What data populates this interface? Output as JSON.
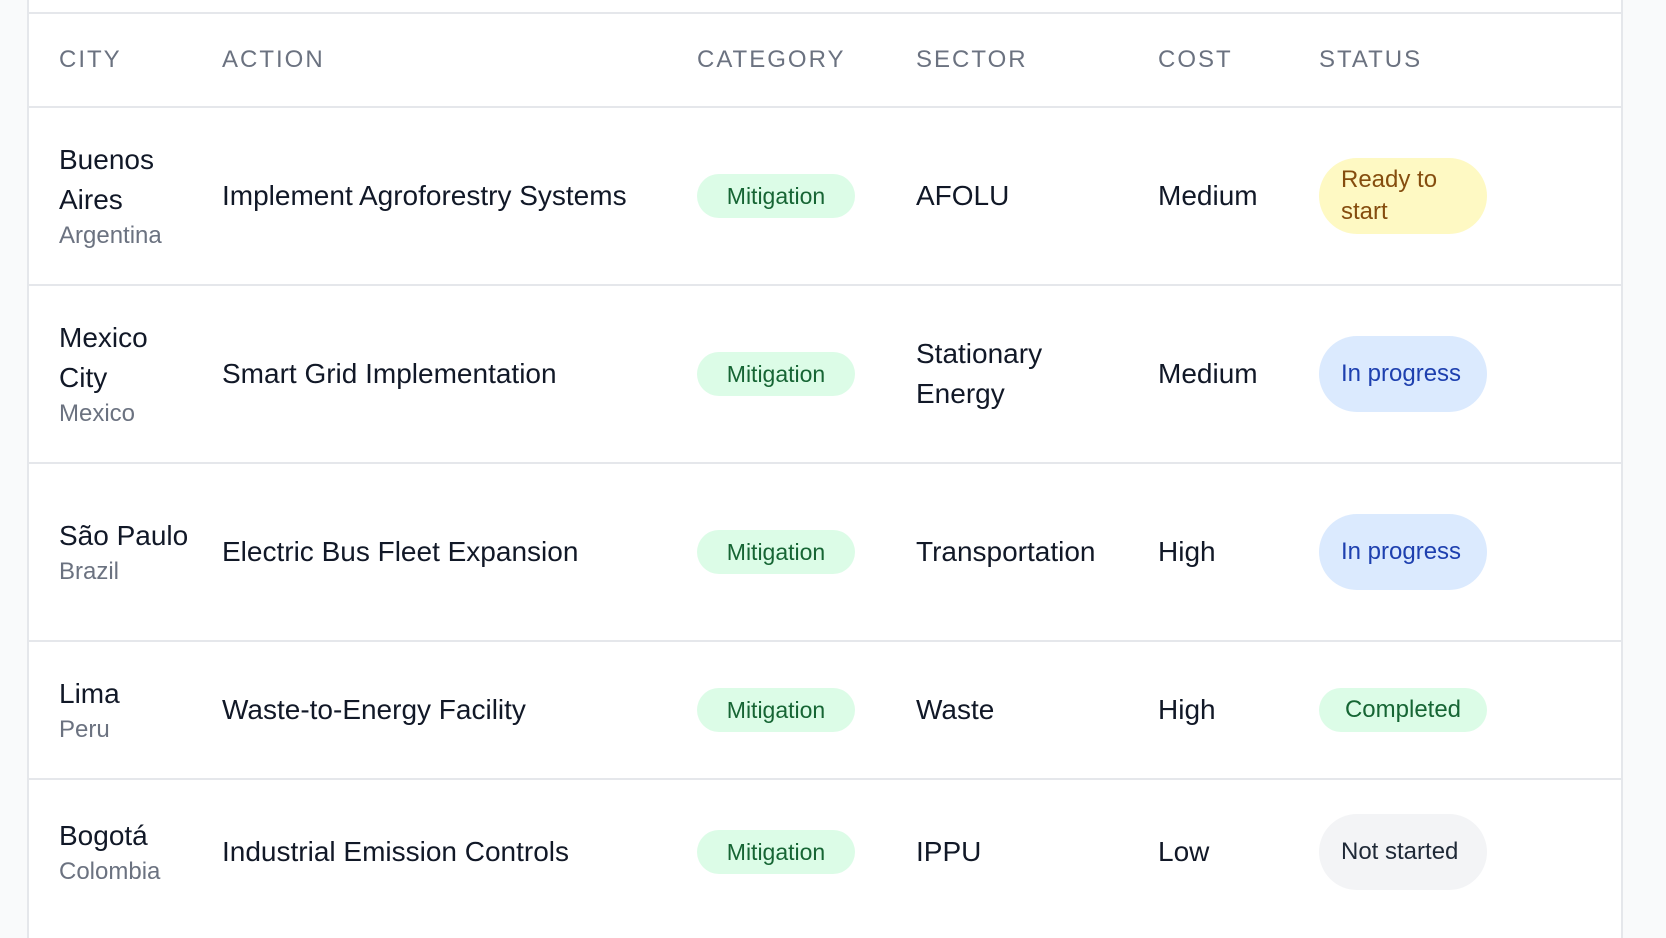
{
  "table": {
    "headers": {
      "city": "CITY",
      "action": "ACTION",
      "category": "CATEGORY",
      "sector": "SECTOR",
      "cost": "COST",
      "status": "STATUS"
    },
    "rows": [
      {
        "city": "Buenos Aires",
        "country": "Argentina",
        "action": "Implement Agroforestry Systems",
        "category": "Mitigation",
        "sector": "AFOLU",
        "cost": "Medium",
        "status": "Ready to start"
      },
      {
        "city": "Mexico City",
        "country": "Mexico",
        "action": "Smart Grid Implementation",
        "category": "Mitigation",
        "sector": "Stationary Energy",
        "cost": "Medium",
        "status": "In progress"
      },
      {
        "city": "São Paulo",
        "country": "Brazil",
        "action": "Electric Bus Fleet Expansion",
        "category": "Mitigation",
        "sector": "Transportation",
        "cost": "High",
        "status": "In progress"
      },
      {
        "city": "Lima",
        "country": "Peru",
        "action": "Waste-to-Energy Facility",
        "category": "Mitigation",
        "sector": "Waste",
        "cost": "High",
        "status": "Completed"
      },
      {
        "city": "Bogotá",
        "country": "Colombia",
        "action": "Industrial Emission Controls",
        "category": "Mitigation",
        "sector": "IPPU",
        "cost": "Low",
        "status": "Not started"
      }
    ]
  },
  "colors": {
    "ready_to_start": "#fef9c3",
    "in_progress": "#dbeafe",
    "completed": "#dcfce7",
    "not_started": "#f3f4f6",
    "mitigation": "#dcfce7"
  }
}
